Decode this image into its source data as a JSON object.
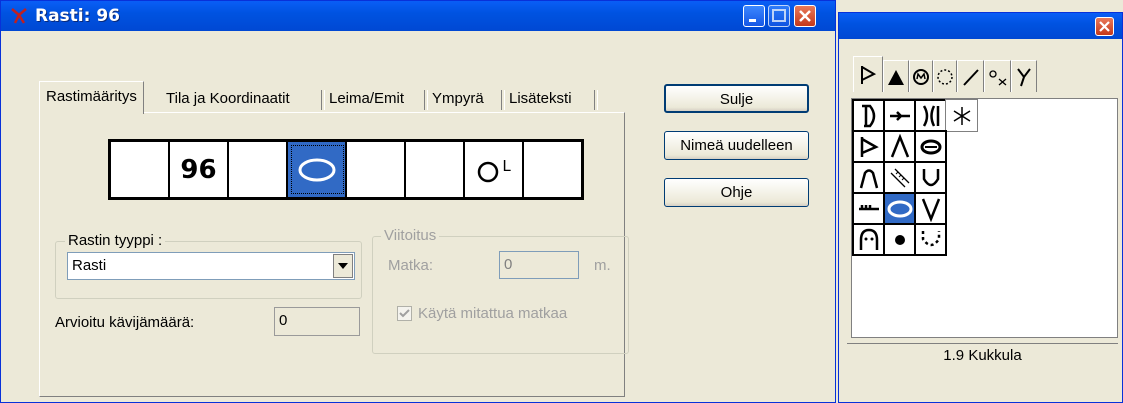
{
  "dialog": {
    "title": "Rasti: 96",
    "tabs": [
      "Rastimääritys",
      "Tila ja Koordinaatit",
      "Leima/Emit",
      "Ympyrä",
      "Lisäteksti"
    ],
    "strip": {
      "code": "96",
      "suffix_letter": "L"
    },
    "rastin_tyyppi": {
      "legend": "Rastin tyyppi :",
      "value": "Rasti"
    },
    "viitoitus": {
      "legend": "Viitoitus",
      "matka_label": "Matka:",
      "matka_value": "0",
      "matka_unit": "m.",
      "checkbox_label": "Käytä mitattua matkaa",
      "checked": true
    },
    "kavijamaara": {
      "label": "Arvioitu kävijämäärä:",
      "value": "0"
    },
    "buttons": {
      "close": "Sulje",
      "rename": "Nimeä uudelleen",
      "help": "Ohje"
    },
    "colors": {
      "titlebar": "#0054e3",
      "selection": "#316ac5",
      "face": "#ece9d8"
    }
  },
  "palette": {
    "status": "1.9 Kukkula",
    "tab_icons": [
      "flag-icon",
      "triangle-icon",
      "circle-m-icon",
      "dotted-circle-icon",
      "slash-icon",
      "small-circles-icon",
      "y-fork-icon"
    ],
    "grid_icons": [
      "d-bracket-icon",
      "arrow-line-icon",
      "double-bracket-icon",
      "asterisk-icon",
      "flag-icon",
      "lambda-icon",
      "filled-oval-icon",
      "arch-icon",
      "ruler-icon",
      "u-icon",
      "tooth-line-icon",
      "oval-icon",
      "v-icon",
      "face-icon",
      "dot-icon",
      "dotted-u-icon"
    ]
  }
}
